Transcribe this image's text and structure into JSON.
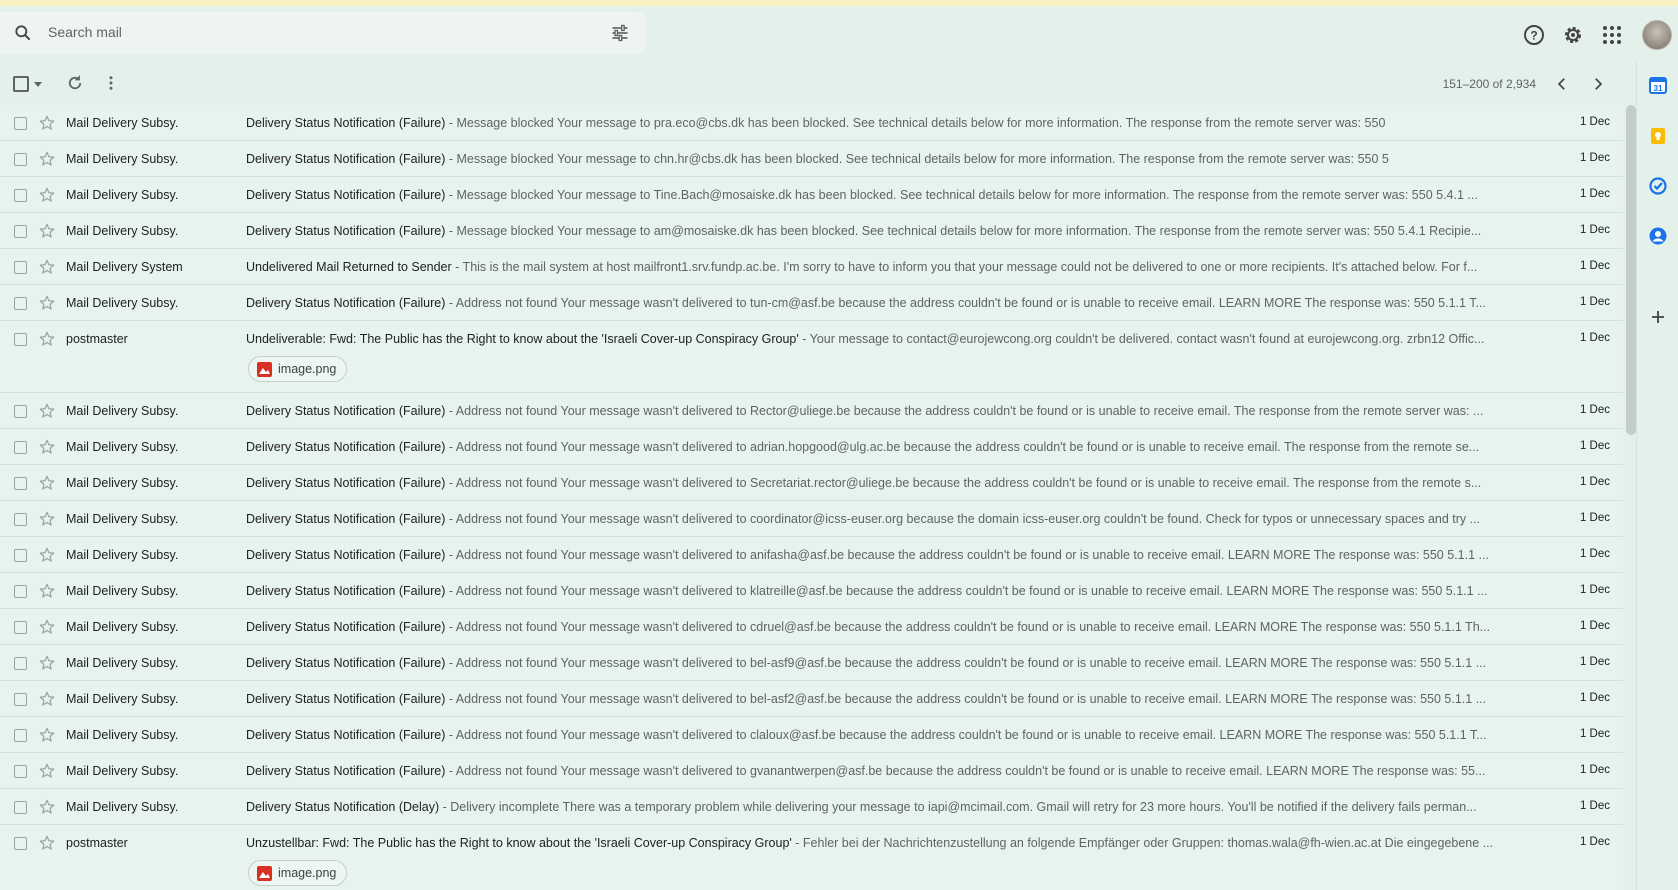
{
  "search": {
    "placeholder": "Search mail"
  },
  "header_icons": [
    "help-icon",
    "settings-icon",
    "apps-grid-icon",
    "account-avatar"
  ],
  "toolbar": {
    "pager": "151–200 of 2,934"
  },
  "side_panel": [
    "calendar-icon",
    "keep-icon",
    "tasks-icon",
    "contacts-icon",
    "add-icon"
  ],
  "emails": [
    {
      "sender": "Mail Delivery Subsy.",
      "subject": "Delivery Status Notification (Failure)",
      "snippet": " - Message blocked Your message to pra.eco@cbs.dk has been blocked. See technical details below for more information. The response from the remote server was: 550",
      "date": "1 Dec"
    },
    {
      "sender": "Mail Delivery Subsy.",
      "subject": "Delivery Status Notification (Failure)",
      "snippet": " - Message blocked Your message to chn.hr@cbs.dk has been blocked. See technical details below for more information. The response from the remote server was: 550 5",
      "date": "1 Dec"
    },
    {
      "sender": "Mail Delivery Subsy.",
      "subject": "Delivery Status Notification (Failure)",
      "snippet": " - Message blocked Your message to Tine.Bach@mosaiske.dk has been blocked. See technical details below for more information. The response from the remote server was: 550 5.4.1 ...",
      "date": "1 Dec"
    },
    {
      "sender": "Mail Delivery Subsy.",
      "subject": "Delivery Status Notification (Failure)",
      "snippet": " - Message blocked Your message to am@mosaiske.dk has been blocked. See technical details below for more information. The response from the remote server was: 550 5.4.1 Recipie...",
      "date": "1 Dec"
    },
    {
      "sender": "Mail Delivery System",
      "subject": "Undelivered Mail Returned to Sender",
      "snippet": " - This is the mail system at host mailfront1.srv.fundp.ac.be. I'm sorry to have to inform you that your message could not be delivered to one or more recipients. It's attached below. For f...",
      "date": "1 Dec"
    },
    {
      "sender": "Mail Delivery Subsy.",
      "subject": "Delivery Status Notification (Failure)",
      "snippet": " - Address not found Your message wasn't delivered to tun-cm@asf.be because the address couldn't be found or is unable to receive email. LEARN MORE The response was: 550 5.1.1 T...",
      "date": "1 Dec"
    },
    {
      "sender": "postmaster",
      "subject": "Undeliverable: Fwd: The Public has the Right to know about the 'Israeli Cover-up Conspiracy Group'",
      "snippet": " - Your message to contact@eurojewcong.org couldn't be delivered. contact wasn't found at eurojewcong.org. zrbn12 Offic...",
      "date": "1 Dec",
      "attachment": "image.png"
    },
    {
      "sender": "Mail Delivery Subsy.",
      "subject": "Delivery Status Notification (Failure)",
      "snippet": " - Address not found Your message wasn't delivered to Rector@uliege.be because the address couldn't be found or is unable to receive email. The response from the remote server was: ...",
      "date": "1 Dec"
    },
    {
      "sender": "Mail Delivery Subsy.",
      "subject": "Delivery Status Notification (Failure)",
      "snippet": " - Address not found Your message wasn't delivered to adrian.hopgood@ulg.ac.be because the address couldn't be found or is unable to receive email. The response from the remote se...",
      "date": "1 Dec"
    },
    {
      "sender": "Mail Delivery Subsy.",
      "subject": "Delivery Status Notification (Failure)",
      "snippet": " - Address not found Your message wasn't delivered to Secretariat.rector@uliege.be because the address couldn't be found or is unable to receive email. The response from the remote s...",
      "date": "1 Dec"
    },
    {
      "sender": "Mail Delivery Subsy.",
      "subject": "Delivery Status Notification (Failure)",
      "snippet": " - Address not found Your message wasn't delivered to coordinator@icss-euser.org because the domain icss-euser.org couldn't be found. Check for typos or unnecessary spaces and try ...",
      "date": "1 Dec"
    },
    {
      "sender": "Mail Delivery Subsy.",
      "subject": "Delivery Status Notification (Failure)",
      "snippet": " - Address not found Your message wasn't delivered to anifasha@asf.be because the address couldn't be found or is unable to receive email. LEARN MORE The response was: 550 5.1.1 ...",
      "date": "1 Dec"
    },
    {
      "sender": "Mail Delivery Subsy.",
      "subject": "Delivery Status Notification (Failure)",
      "snippet": " - Address not found Your message wasn't delivered to klatreille@asf.be because the address couldn't be found or is unable to receive email. LEARN MORE The response was: 550 5.1.1 ...",
      "date": "1 Dec"
    },
    {
      "sender": "Mail Delivery Subsy.",
      "subject": "Delivery Status Notification (Failure)",
      "snippet": " - Address not found Your message wasn't delivered to cdruel@asf.be because the address couldn't be found or is unable to receive email. LEARN MORE The response was: 550 5.1.1 Th...",
      "date": "1 Dec"
    },
    {
      "sender": "Mail Delivery Subsy.",
      "subject": "Delivery Status Notification (Failure)",
      "snippet": " - Address not found Your message wasn't delivered to bel-asf9@asf.be because the address couldn't be found or is unable to receive email. LEARN MORE The response was: 550 5.1.1 ...",
      "date": "1 Dec"
    },
    {
      "sender": "Mail Delivery Subsy.",
      "subject": "Delivery Status Notification (Failure)",
      "snippet": " - Address not found Your message wasn't delivered to bel-asf2@asf.be because the address couldn't be found or is unable to receive email. LEARN MORE The response was: 550 5.1.1 ...",
      "date": "1 Dec"
    },
    {
      "sender": "Mail Delivery Subsy.",
      "subject": "Delivery Status Notification (Failure)",
      "snippet": " - Address not found Your message wasn't delivered to claloux@asf.be because the address couldn't be found or is unable to receive email. LEARN MORE The response was: 550 5.1.1 T...",
      "date": "1 Dec"
    },
    {
      "sender": "Mail Delivery Subsy.",
      "subject": "Delivery Status Notification (Failure)",
      "snippet": " - Address not found Your message wasn't delivered to gvanantwerpen@asf.be because the address couldn't be found or is unable to receive email. LEARN MORE The response was: 55...",
      "date": "1 Dec"
    },
    {
      "sender": "Mail Delivery Subsy.",
      "subject": "Delivery Status Notification (Delay)",
      "snippet": " - Delivery incomplete There was a temporary problem while delivering your message to iapi@mcimail.com. Gmail will retry for 23 more hours. You'll be notified if the delivery fails perman...",
      "date": "1 Dec"
    },
    {
      "sender": "postmaster",
      "subject": "Unzustellbar: Fwd: The Public has the Right to know about the 'Israeli Cover-up Conspiracy Group'",
      "snippet": " - Fehler bei der Nachrichtenzustellung an folgende Empfänger oder Gruppen: thomas.wala@fh-wien.ac.at Die eingegebene ...",
      "date": "1 Dec",
      "attachment": "image.png"
    }
  ]
}
